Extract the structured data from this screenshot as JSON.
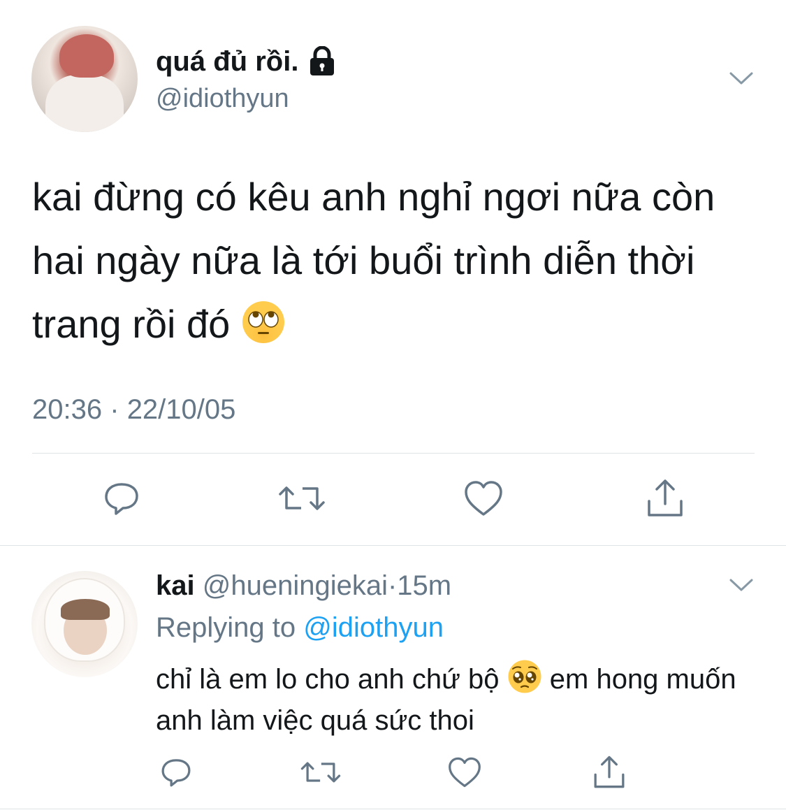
{
  "main_tweet": {
    "author_name": "quá đủ rồi.",
    "author_handle": "@idiothyun",
    "text": "kai đừng có kêu anh nghỉ ngơi nữa còn hai ngày nữa là tới buổi trình diễn thời trang rồi đó",
    "text_emoji": "face-with-rolling-eyes",
    "time": "20:36",
    "separator": "·",
    "date": "22/10/05",
    "protected_icon": "lock-icon"
  },
  "reply_tweet": {
    "author_name": "kai",
    "author_handle": "@hueningiekai",
    "separator": "·",
    "age": "15m",
    "replying_label": "Replying to",
    "replying_to": "@idiothyun",
    "text_before_emoji": "chỉ là em lo cho anh chứ bộ",
    "text_emoji": "pleading-face",
    "text_after_emoji": "em hong muốn anh làm việc quá sức thoi"
  },
  "actions": [
    "reply-icon",
    "retweet-icon",
    "like-icon",
    "share-icon"
  ],
  "colors": {
    "text": "#14171a",
    "secondary": "#657786",
    "link": "#1da1f2",
    "divider": "#dfe3e6"
  }
}
